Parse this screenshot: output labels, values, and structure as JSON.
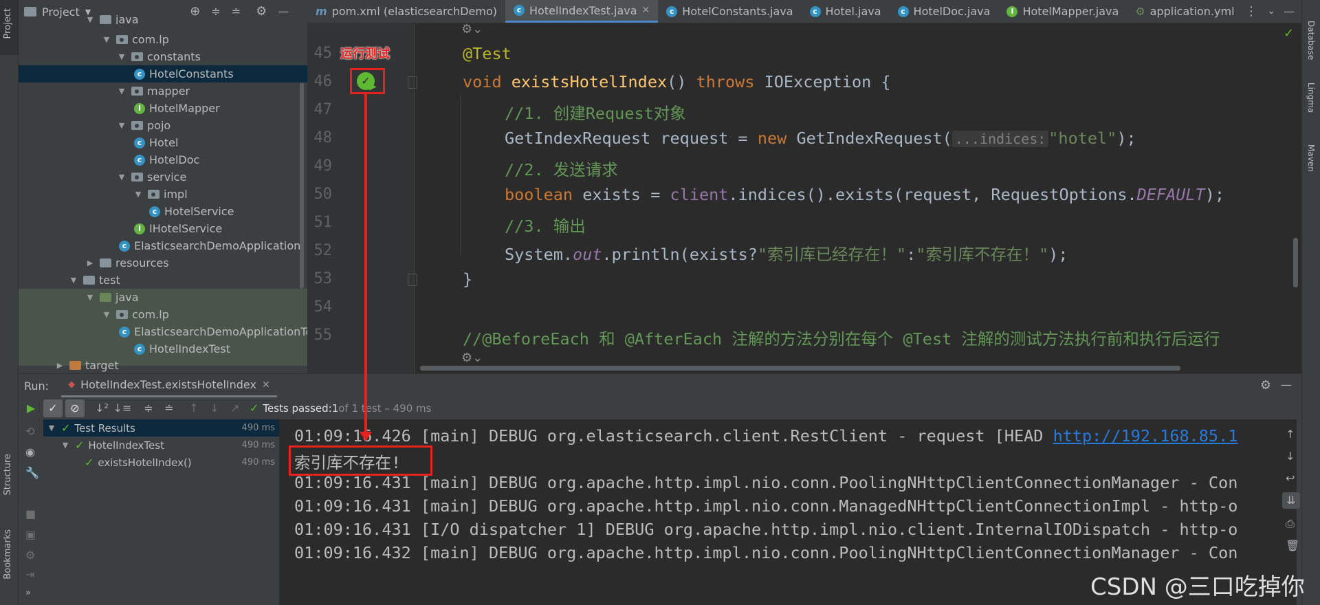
{
  "left_stripe": {
    "project": "Project",
    "structure": "Structure",
    "bookmarks": "Bookmarks"
  },
  "right_stripe": {
    "database": "Database",
    "lingma": "Lingma",
    "maven": "Maven"
  },
  "project_panel": {
    "title": "Project",
    "tree": [
      {
        "label": "java",
        "icon": "folder"
      },
      {
        "label": "com.lp",
        "icon": "package"
      },
      {
        "label": "constants",
        "icon": "package"
      },
      {
        "label": "HotelConstants",
        "icon": "class"
      },
      {
        "label": "mapper",
        "icon": "package"
      },
      {
        "label": "HotelMapper",
        "icon": "interface"
      },
      {
        "label": "pojo",
        "icon": "package"
      },
      {
        "label": "Hotel",
        "icon": "class"
      },
      {
        "label": "HotelDoc",
        "icon": "class"
      },
      {
        "label": "service",
        "icon": "package"
      },
      {
        "label": "impl",
        "icon": "package"
      },
      {
        "label": "HotelService",
        "icon": "class"
      },
      {
        "label": "IHotelService",
        "icon": "interface"
      },
      {
        "label": "ElasticsearchDemoApplication",
        "icon": "class"
      },
      {
        "label": "resources",
        "icon": "folder"
      },
      {
        "label": "test",
        "icon": "folder"
      },
      {
        "label": "java",
        "icon": "test-folder"
      },
      {
        "label": "com.lp",
        "icon": "package"
      },
      {
        "label": "ElasticsearchDemoApplicationTest",
        "icon": "class"
      },
      {
        "label": "HotelIndexTest",
        "icon": "class"
      },
      {
        "label": "target",
        "icon": "excluded-folder"
      }
    ]
  },
  "tabs": [
    {
      "label": "pom.xml (elasticsearchDemo)",
      "icon": "maven-icon"
    },
    {
      "label": "HotelIndexTest.java",
      "icon": "class-icon",
      "active": true
    },
    {
      "label": "HotelConstants.java",
      "icon": "class-icon"
    },
    {
      "label": "Hotel.java",
      "icon": "class-icon"
    },
    {
      "label": "HotelDoc.java",
      "icon": "class-icon"
    },
    {
      "label": "HotelMapper.java",
      "icon": "interface-icon"
    },
    {
      "label": "application.yml",
      "icon": "yaml-icon"
    }
  ],
  "editor": {
    "annotation_label": "运行测试",
    "line_numbers": [
      "45",
      "46",
      "47",
      "48",
      "49",
      "50",
      "51",
      "52",
      "53",
      "54",
      "55"
    ],
    "lines": {
      "l45_ann": "@Test",
      "l46_void": "void ",
      "l46_name": "existsHotelIndex",
      "l46_rest1": "() ",
      "l46_throws": "throws ",
      "l46_rest2": "IOException {",
      "l47": "//1. 创建Request对象",
      "l48_a": "GetIndexRequest request = ",
      "l48_new": "new ",
      "l48_b": "GetIndexRequest(",
      "l48_hint": "...indices:",
      "l48_str": "\"hotel\"",
      "l48_c": ");",
      "l49": "//2. 发送请求",
      "l50_kw": "boolean ",
      "l50_a": "exists = ",
      "l50_fld": "client",
      "l50_b": ".indices().exists(request, RequestOptions.",
      "l50_const": "DEFAULT",
      "l50_c": ");",
      "l51": "//3. 输出",
      "l52_a": "System.",
      "l52_out": "out",
      "l52_b": ".println(exists?",
      "l52_s1": "\"索引库已经存在！\"",
      "l52_c": ":",
      "l52_s2": "\"索引库不存在！\"",
      "l52_d": ");",
      "l53": "}",
      "l54": "",
      "l55": "//@BeforeEach 和 @AfterEach 注解的方法分别在每个 @Test 注解的测试方法执行前和执行后运行"
    }
  },
  "run_panel": {
    "label": "Run:",
    "config": "HotelIndexTest.existsHotelIndex",
    "status_prefix": "Tests passed: ",
    "status_count": "1",
    "status_suffix": " of 1 test – 490 ms",
    "tree": [
      {
        "label": "Test Results",
        "time": "490 ms"
      },
      {
        "label": "HotelIndexTest",
        "time": "490 ms"
      },
      {
        "label": "existsHotelIndex()",
        "time": "490 ms"
      }
    ],
    "console": [
      {
        "text": "01:09:16.426 [main] DEBUG org.elasticsearch.client.RestClient - request [HEAD ",
        "link": "http://192.168.85.1"
      },
      {
        "text": "索引库不存在!"
      },
      {
        "text": "01:09:16.431 [main] DEBUG org.apache.http.impl.nio.conn.PoolingNHttpClientConnectionManager - Con"
      },
      {
        "text": "01:09:16.431 [main] DEBUG org.apache.http.impl.nio.conn.ManagedNHttpClientConnectionImpl - http-o"
      },
      {
        "text": "01:09:16.431 [I/O dispatcher 1] DEBUG org.apache.http.impl.nio.client.InternalIODispatch - http-o"
      },
      {
        "text": "01:09:16.432 [main] DEBUG org.apache.http.impl.nio.conn.PoolingNHttpClientConnectionManager - Con"
      }
    ]
  },
  "watermark": "CSDN @三口吃掉你",
  "colors": {
    "highlight_red": "#e8221f",
    "selection": "#0d293e",
    "pass_green": "#5fb832"
  }
}
